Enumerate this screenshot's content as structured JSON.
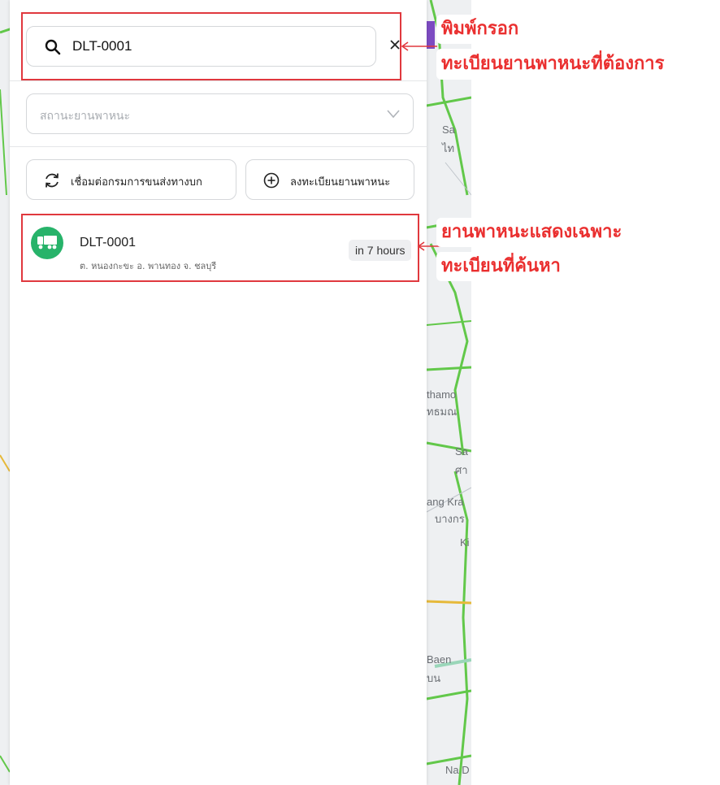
{
  "search": {
    "value": "DLT-0001"
  },
  "filters": {
    "status_placeholder": "สถานะยานพาหนะ"
  },
  "actions": {
    "sync_label": "เชื่อมต่อกรมการขนส่งทางบก",
    "add_label": "ลงทะเบียนยานพาหนะ"
  },
  "vehicles": [
    {
      "plate": "DLT-0001",
      "location": "ต. หนองกะขะ อ. พานทอง จ. ชลบุรี",
      "time": "in 7 hours"
    }
  ],
  "annotations": {
    "search_line1": "พิมพ์กรอก",
    "search_line2": "ทะเบียนยานพาหนะที่ต้องการ",
    "result_line1": "ยานพาหนะแสดงเฉพาะ",
    "result_line2": "ทะเบียนที่ค้นหา"
  },
  "map": {
    "labels": [
      "Sa",
      "ไท",
      "thamo",
      "ทธมณ",
      "Sa",
      "ศา",
      "ang Kra",
      "บางกร",
      "Ki",
      "Baen",
      "บน",
      "Na D"
    ]
  },
  "colors": {
    "accent_red": "#e0383e",
    "avatar_green": "#27b36a",
    "road_green": "#4cc23a"
  }
}
